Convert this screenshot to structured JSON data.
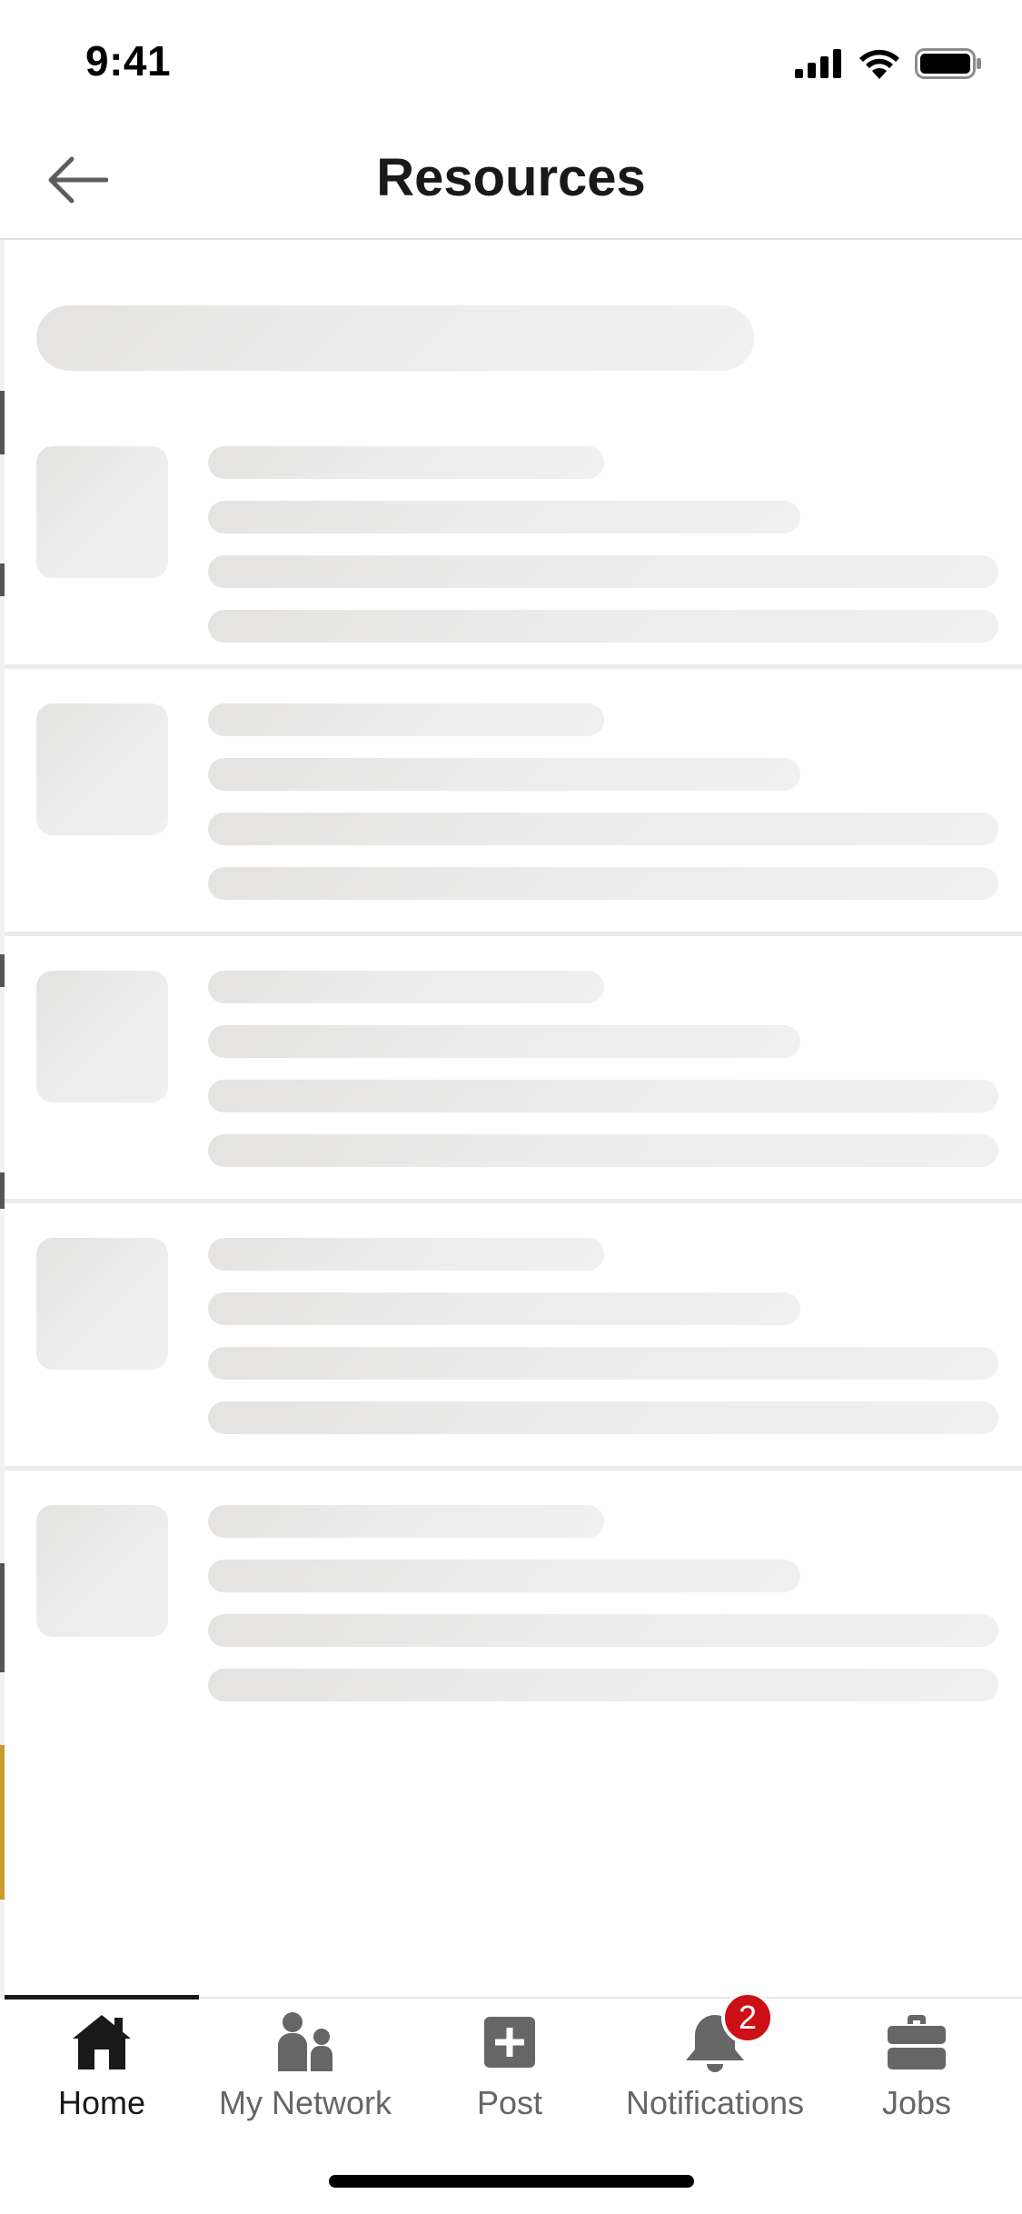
{
  "status_bar": {
    "time": "9:41"
  },
  "header": {
    "title": "Resources",
    "back_icon": "arrow-left-icon"
  },
  "loading": {
    "state": "skeleton",
    "row_count": 5
  },
  "tab_bar": {
    "active_tab": "Home",
    "tabs": [
      {
        "label": "Home",
        "icon": "home-icon"
      },
      {
        "label": "My Network",
        "icon": "people-icon"
      },
      {
        "label": "Post",
        "icon": "plus-square-icon"
      },
      {
        "label": "Notifications",
        "icon": "bell-icon",
        "badge": "2"
      },
      {
        "label": "Jobs",
        "icon": "briefcase-icon"
      }
    ]
  },
  "colors": {
    "text_primary": "#191919",
    "text_secondary": "#666666",
    "skeleton": "#ebebeb",
    "badge": "#cc1016"
  }
}
